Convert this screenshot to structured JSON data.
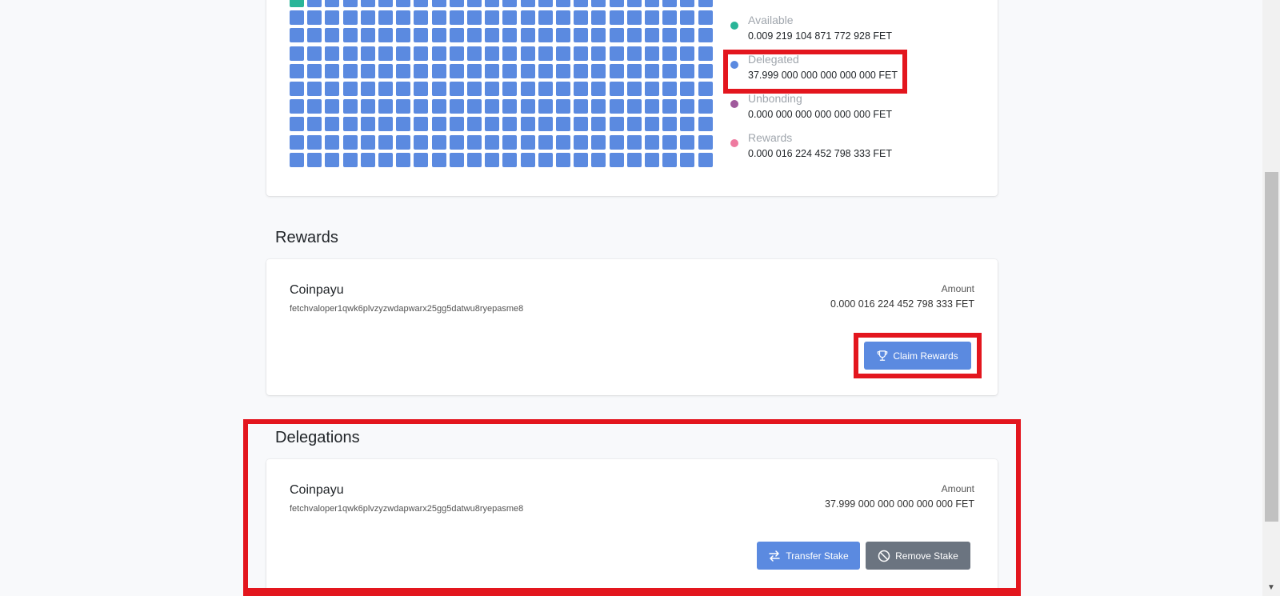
{
  "balance": {
    "legend": [
      {
        "label": "Available",
        "value": "0.009 219 104 871 772 928 FET",
        "color": "#29b598"
      },
      {
        "label": "Delegated",
        "value": "37.999 000 000 000 000 000 FET",
        "color": "#5b8ae0"
      },
      {
        "label": "Unbonding",
        "value": "0.000 000 000 000 000 000 FET",
        "color": "#a05a9c"
      },
      {
        "label": "Rewards",
        "value": "0.000 016 224 452 798 333 FET",
        "color": "#ee7aa0"
      }
    ]
  },
  "rewards": {
    "title": "Rewards",
    "validator_name": "Coinpayu",
    "validator_address": "fetchvaloper1qwk6plvzyzwdapwarx25gg5datwu8ryepasme8",
    "amount_label": "Amount",
    "amount_value": "0.000 016 224 452 798 333 FET",
    "claim_button": "Claim Rewards"
  },
  "delegations": {
    "title": "Delegations",
    "validator_name": "Coinpayu",
    "validator_address": "fetchvaloper1qwk6plvzyzwdapwarx25gg5datwu8ryepasme8",
    "amount_label": "Amount",
    "amount_value": "37.999 000 000 000 000 000 FET",
    "transfer_button": "Transfer Stake",
    "remove_button": "Remove Stake"
  },
  "colors": {
    "accent": "#5b8ae0",
    "available": "#29b598",
    "highlight": "#e3161e",
    "secondary_button": "#6b7480"
  },
  "icons": {
    "claim": "trophy-icon",
    "transfer": "transfer-arrows-icon",
    "remove": "ban-icon"
  }
}
